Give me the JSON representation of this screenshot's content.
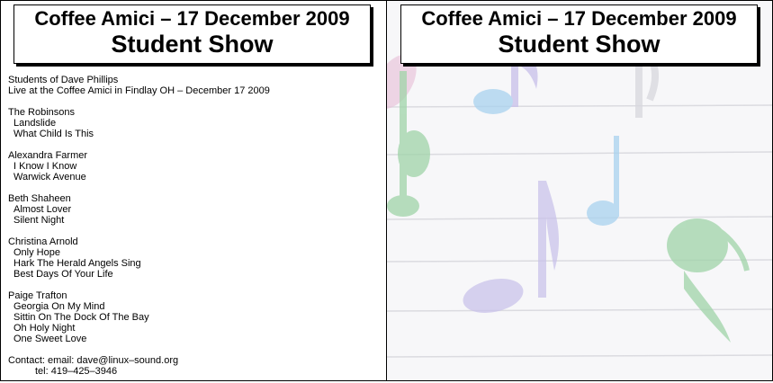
{
  "cover": {
    "title_line1": "Coffee Amici – 17 December 2009",
    "title_line2": "Student Show"
  },
  "intro": {
    "line1": "Students of Dave Phillips",
    "line2": "Live at the Coffee Amici in Findlay OH – December 17 2009"
  },
  "performers": [
    {
      "name": "The Robinsons",
      "songs": [
        "Landslide",
        "What Child Is This"
      ]
    },
    {
      "name": "Alexandra Farmer",
      "songs": [
        "I Know I Know",
        "Warwick Avenue"
      ]
    },
    {
      "name": "Beth Shaheen",
      "songs": [
        "Almost Lover",
        "Silent Night"
      ]
    },
    {
      "name": "Christina Arnold",
      "songs": [
        "Only Hope",
        "Hark The Herald Angels Sing",
        "Best Days Of Your Life"
      ]
    },
    {
      "name": "Paige Trafton",
      "songs": [
        "Georgia On My Mind",
        "Sittin On The Dock Of The Bay",
        "Oh Holy Night",
        "One Sweet Love"
      ]
    }
  ],
  "contact": {
    "email_line": "Contact: email: dave@linux–sound.org",
    "tel_line": "tel: 419–425–3946"
  },
  "colors": {
    "note_green": "#9fd4a8",
    "note_blue": "#a9d2ef",
    "note_purple": "#c8c0ea",
    "note_pink": "#e8c4dc"
  }
}
